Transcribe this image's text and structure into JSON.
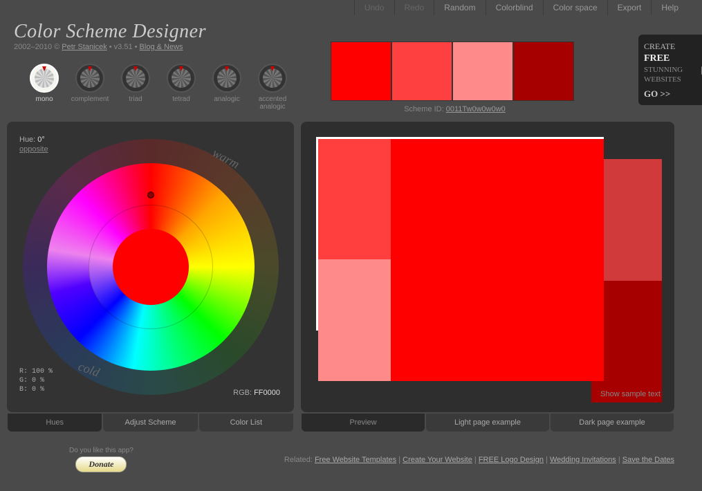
{
  "topmenu": {
    "undo": "Undo",
    "redo": "Redo",
    "random": "Random",
    "colorblind": "Colorblind",
    "colorspace": "Color space",
    "export": "Export",
    "help": "Help"
  },
  "app": {
    "title": "Color Scheme Designer",
    "copyright": "2002–2010 © ",
    "author": "Petr Stanicek",
    "version": " • v3.51 • ",
    "blog": "Blog & News"
  },
  "scheme_types": {
    "mono": "mono",
    "complement": "complement",
    "triad": "triad",
    "tetrad": "tetrad",
    "analogic": "analogic",
    "accented": "accented analogic"
  },
  "swatches": {
    "c0": "#ff0000",
    "c1": "#ff4040",
    "c2": "#ff8a8a",
    "c3": "#a60000"
  },
  "scheme_id": {
    "label": "Scheme ID: ",
    "value": "0011Tw0w0w0w0"
  },
  "promo": {
    "l1": "CREATE",
    "l2": "FREE",
    "l3": "STUNNING",
    "l4": "WEBSITES",
    "go": "GO >>"
  },
  "hue": {
    "label": "Hue: ",
    "value": "0°",
    "opposite": "opposite",
    "rgb_r": "R: 100 %",
    "rgb_g": "G:   0 %",
    "rgb_b": "B:   0 %",
    "hex_label": "RGB: ",
    "hex_value": "FF0000",
    "warm": "warm",
    "cold": "cold"
  },
  "tabs_left": {
    "hues": "Hues",
    "adjust": "Adjust Scheme",
    "list": "Color List"
  },
  "tabs_right": {
    "preview": "Preview",
    "light": "Light page example",
    "dark": "Dark page example"
  },
  "show_sample": "Show sample text",
  "footer": {
    "donate_q": "Do you like this app?",
    "donate_btn": "Donate",
    "related_label": "Related: ",
    "r1": "Free Website Templates",
    "r2": "Create Your Website",
    "r3": "FREE Logo Design",
    "r4": "Wedding Invitations",
    "r5": "Save the Dates"
  }
}
